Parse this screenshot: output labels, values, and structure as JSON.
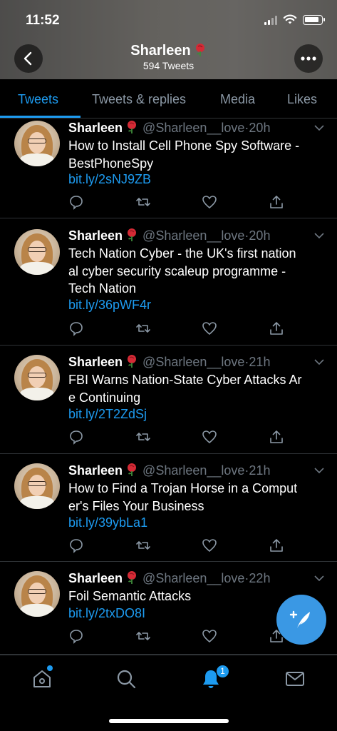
{
  "status_bar": {
    "time": "11:52"
  },
  "header": {
    "title": "Sharleen",
    "subtitle": "594 Tweets"
  },
  "tabs": [
    {
      "label": "Tweets",
      "active": true
    },
    {
      "label": "Tweets & replies",
      "active": false
    },
    {
      "label": "Media",
      "active": false
    },
    {
      "label": "Likes",
      "active": false
    }
  ],
  "tweets": [
    {
      "name": "Sharleen",
      "handle": "@Sharleen__love",
      "time": "20h",
      "text": [
        "How to Install Cell Phone Spy Software -",
        "BestPhoneSpy"
      ],
      "link": "bit.ly/2sNJ9ZB"
    },
    {
      "name": "Sharleen",
      "handle": "@Sharleen__love",
      "time": "20h",
      "text": [
        "Tech Nation Cyber - the UK's first nation",
        "al cyber security scaleup programme -",
        "Tech Nation"
      ],
      "link": "bit.ly/36pWF4r"
    },
    {
      "name": "Sharleen",
      "handle": "@Sharleen__love",
      "time": "21h",
      "text": [
        "FBI Warns Nation-State Cyber Attacks Ar",
        "e Continuing"
      ],
      "link": "bit.ly/2T2ZdSj"
    },
    {
      "name": "Sharleen",
      "handle": "@Sharleen__love",
      "time": "21h",
      "text": [
        "How to Find a Trojan Horse in a Comput",
        "er's Files Your Business"
      ],
      "link": "bit.ly/39ybLa1"
    },
    {
      "name": "Sharleen",
      "handle": "@Sharleen__love",
      "time": "22h",
      "text": [
        "Foil Semantic Attacks"
      ],
      "link": "bit.ly/2txDO8I"
    }
  ],
  "bottom_nav": {
    "notification_count": "1"
  },
  "colors": {
    "accent": "#1d9bf0",
    "background": "#000000",
    "muted": "#6e7781"
  }
}
